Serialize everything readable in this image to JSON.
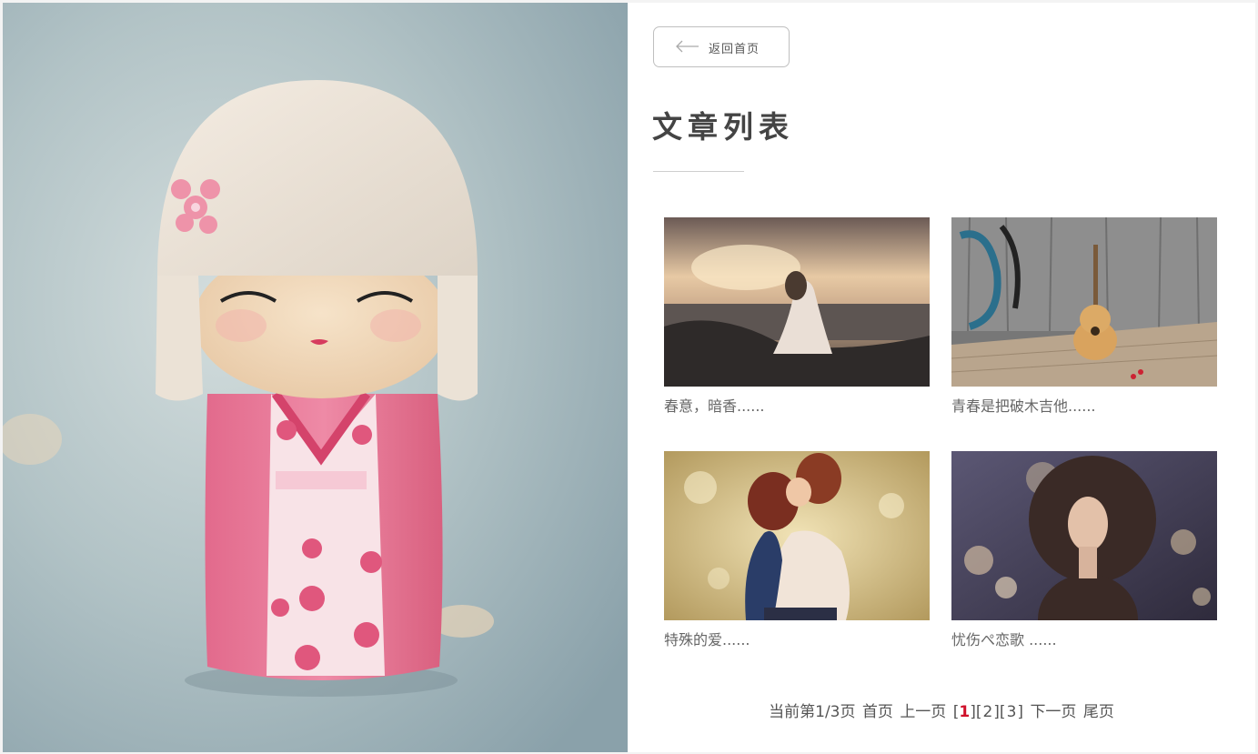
{
  "nav": {
    "back_label": "返回首页"
  },
  "page": {
    "title": "文章列表"
  },
  "articles": [
    {
      "caption": "春意，暗香......"
    },
    {
      "caption": "青春是把破木吉他......"
    },
    {
      "caption": "特殊的爱......"
    },
    {
      "caption": "忧伤ぺ恋歌 ......"
    }
  ],
  "pagination": {
    "status": "当前第1/3页",
    "first": "首页",
    "prev": "上一页",
    "pages": [
      "1",
      "2",
      "3"
    ],
    "current": "1",
    "next": "下一页",
    "last": "尾页"
  },
  "colors": {
    "accent": "#d0112b",
    "text": "#555555",
    "border": "#bfbfbf"
  }
}
